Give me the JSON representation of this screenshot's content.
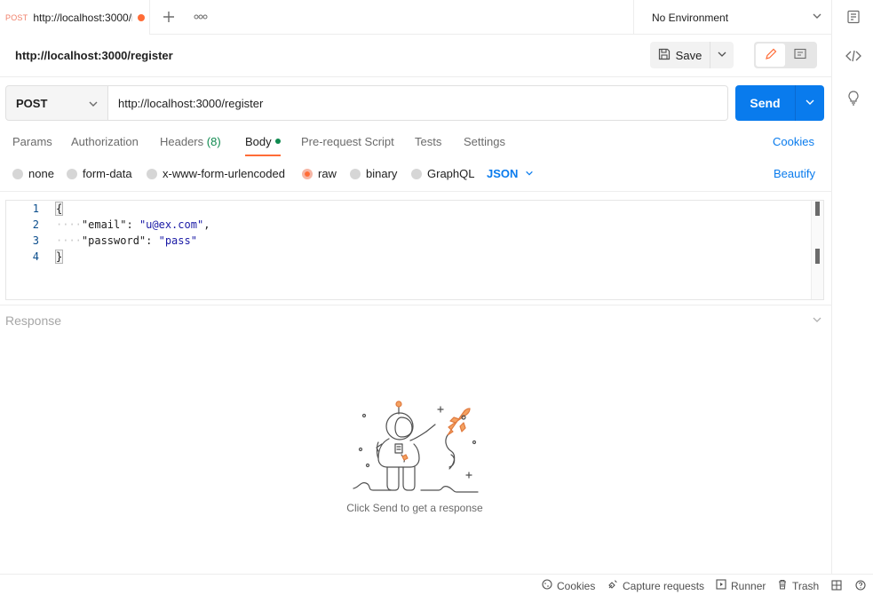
{
  "tabs": [
    {
      "method": "POST",
      "title": "http://localhost:3000/register",
      "unsaved": true
    }
  ],
  "tabbar": {
    "add_icon": "plus-icon",
    "more_icon": "more-horizontal-icon"
  },
  "environment": {
    "selected": "No Environment"
  },
  "request": {
    "name": "http://localhost:3000/register",
    "method": "POST",
    "url": "http://localhost:3000/register"
  },
  "toolbar": {
    "save_label": "Save",
    "send_label": "Send"
  },
  "request_tabs": {
    "params": "Params",
    "authorization": "Authorization",
    "headers": "Headers",
    "headers_count": "(8)",
    "body": "Body",
    "prerequest": "Pre-request Script",
    "tests": "Tests",
    "settings": "Settings",
    "cookies": "Cookies"
  },
  "body_types": {
    "none": "none",
    "form_data": "form-data",
    "urlencoded": "x-www-form-urlencoded",
    "raw": "raw",
    "binary": "binary",
    "graphql": "GraphQL",
    "language": "JSON",
    "beautify": "Beautify"
  },
  "editor": {
    "lines": [
      {
        "n": "1",
        "text": "{"
      },
      {
        "n": "2",
        "indent": "····",
        "key": "\"email\"",
        "sep": ": ",
        "value": "\"u@ex.com\"",
        "end": ","
      },
      {
        "n": "3",
        "indent": "····",
        "key": "\"password\"",
        "sep": ": ",
        "value": "\"pass\"",
        "end": ""
      },
      {
        "n": "4",
        "text": "}"
      }
    ]
  },
  "response": {
    "title": "Response",
    "empty_message": "Click Send to get a response"
  },
  "statusbar": {
    "cookies": "Cookies",
    "capture": "Capture requests",
    "runner": "Runner",
    "trash": "Trash"
  },
  "colors": {
    "accent": "#ff6c37",
    "primary": "#097bed",
    "success": "#0f8a4f"
  }
}
